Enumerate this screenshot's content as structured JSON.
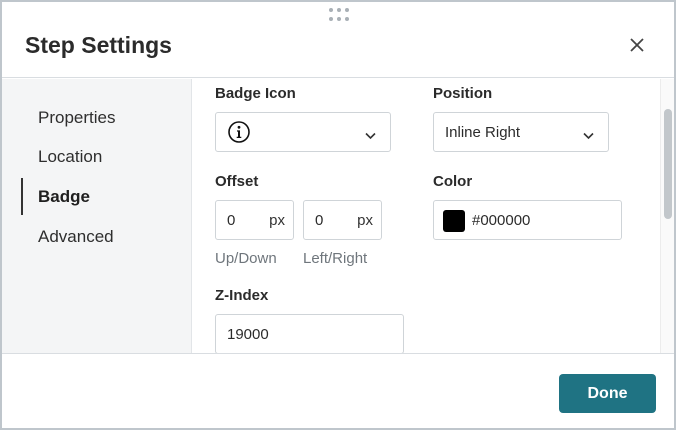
{
  "dialog": {
    "title": "Step Settings",
    "done_label": "Done"
  },
  "sidebar": {
    "items": [
      {
        "label": "Properties",
        "active": false
      },
      {
        "label": "Location",
        "active": false
      },
      {
        "label": "Badge",
        "active": true
      },
      {
        "label": "Advanced",
        "active": false
      }
    ]
  },
  "badge": {
    "icon_label": "Badge Icon",
    "icon_value": "info-circle-icon",
    "position_label": "Position",
    "position_value": "Inline Right",
    "offset_label": "Offset",
    "offset_up_value": "0",
    "offset_up_unit": "px",
    "offset_up_caption": "Up/Down",
    "offset_left_value": "0",
    "offset_left_unit": "px",
    "offset_left_caption": "Left/Right",
    "color_label": "Color",
    "color_value": "#000000",
    "zindex_label": "Z-Index",
    "zindex_value": "19000"
  },
  "colors": {
    "accent": "#1f7383",
    "swatch": "#000000"
  }
}
